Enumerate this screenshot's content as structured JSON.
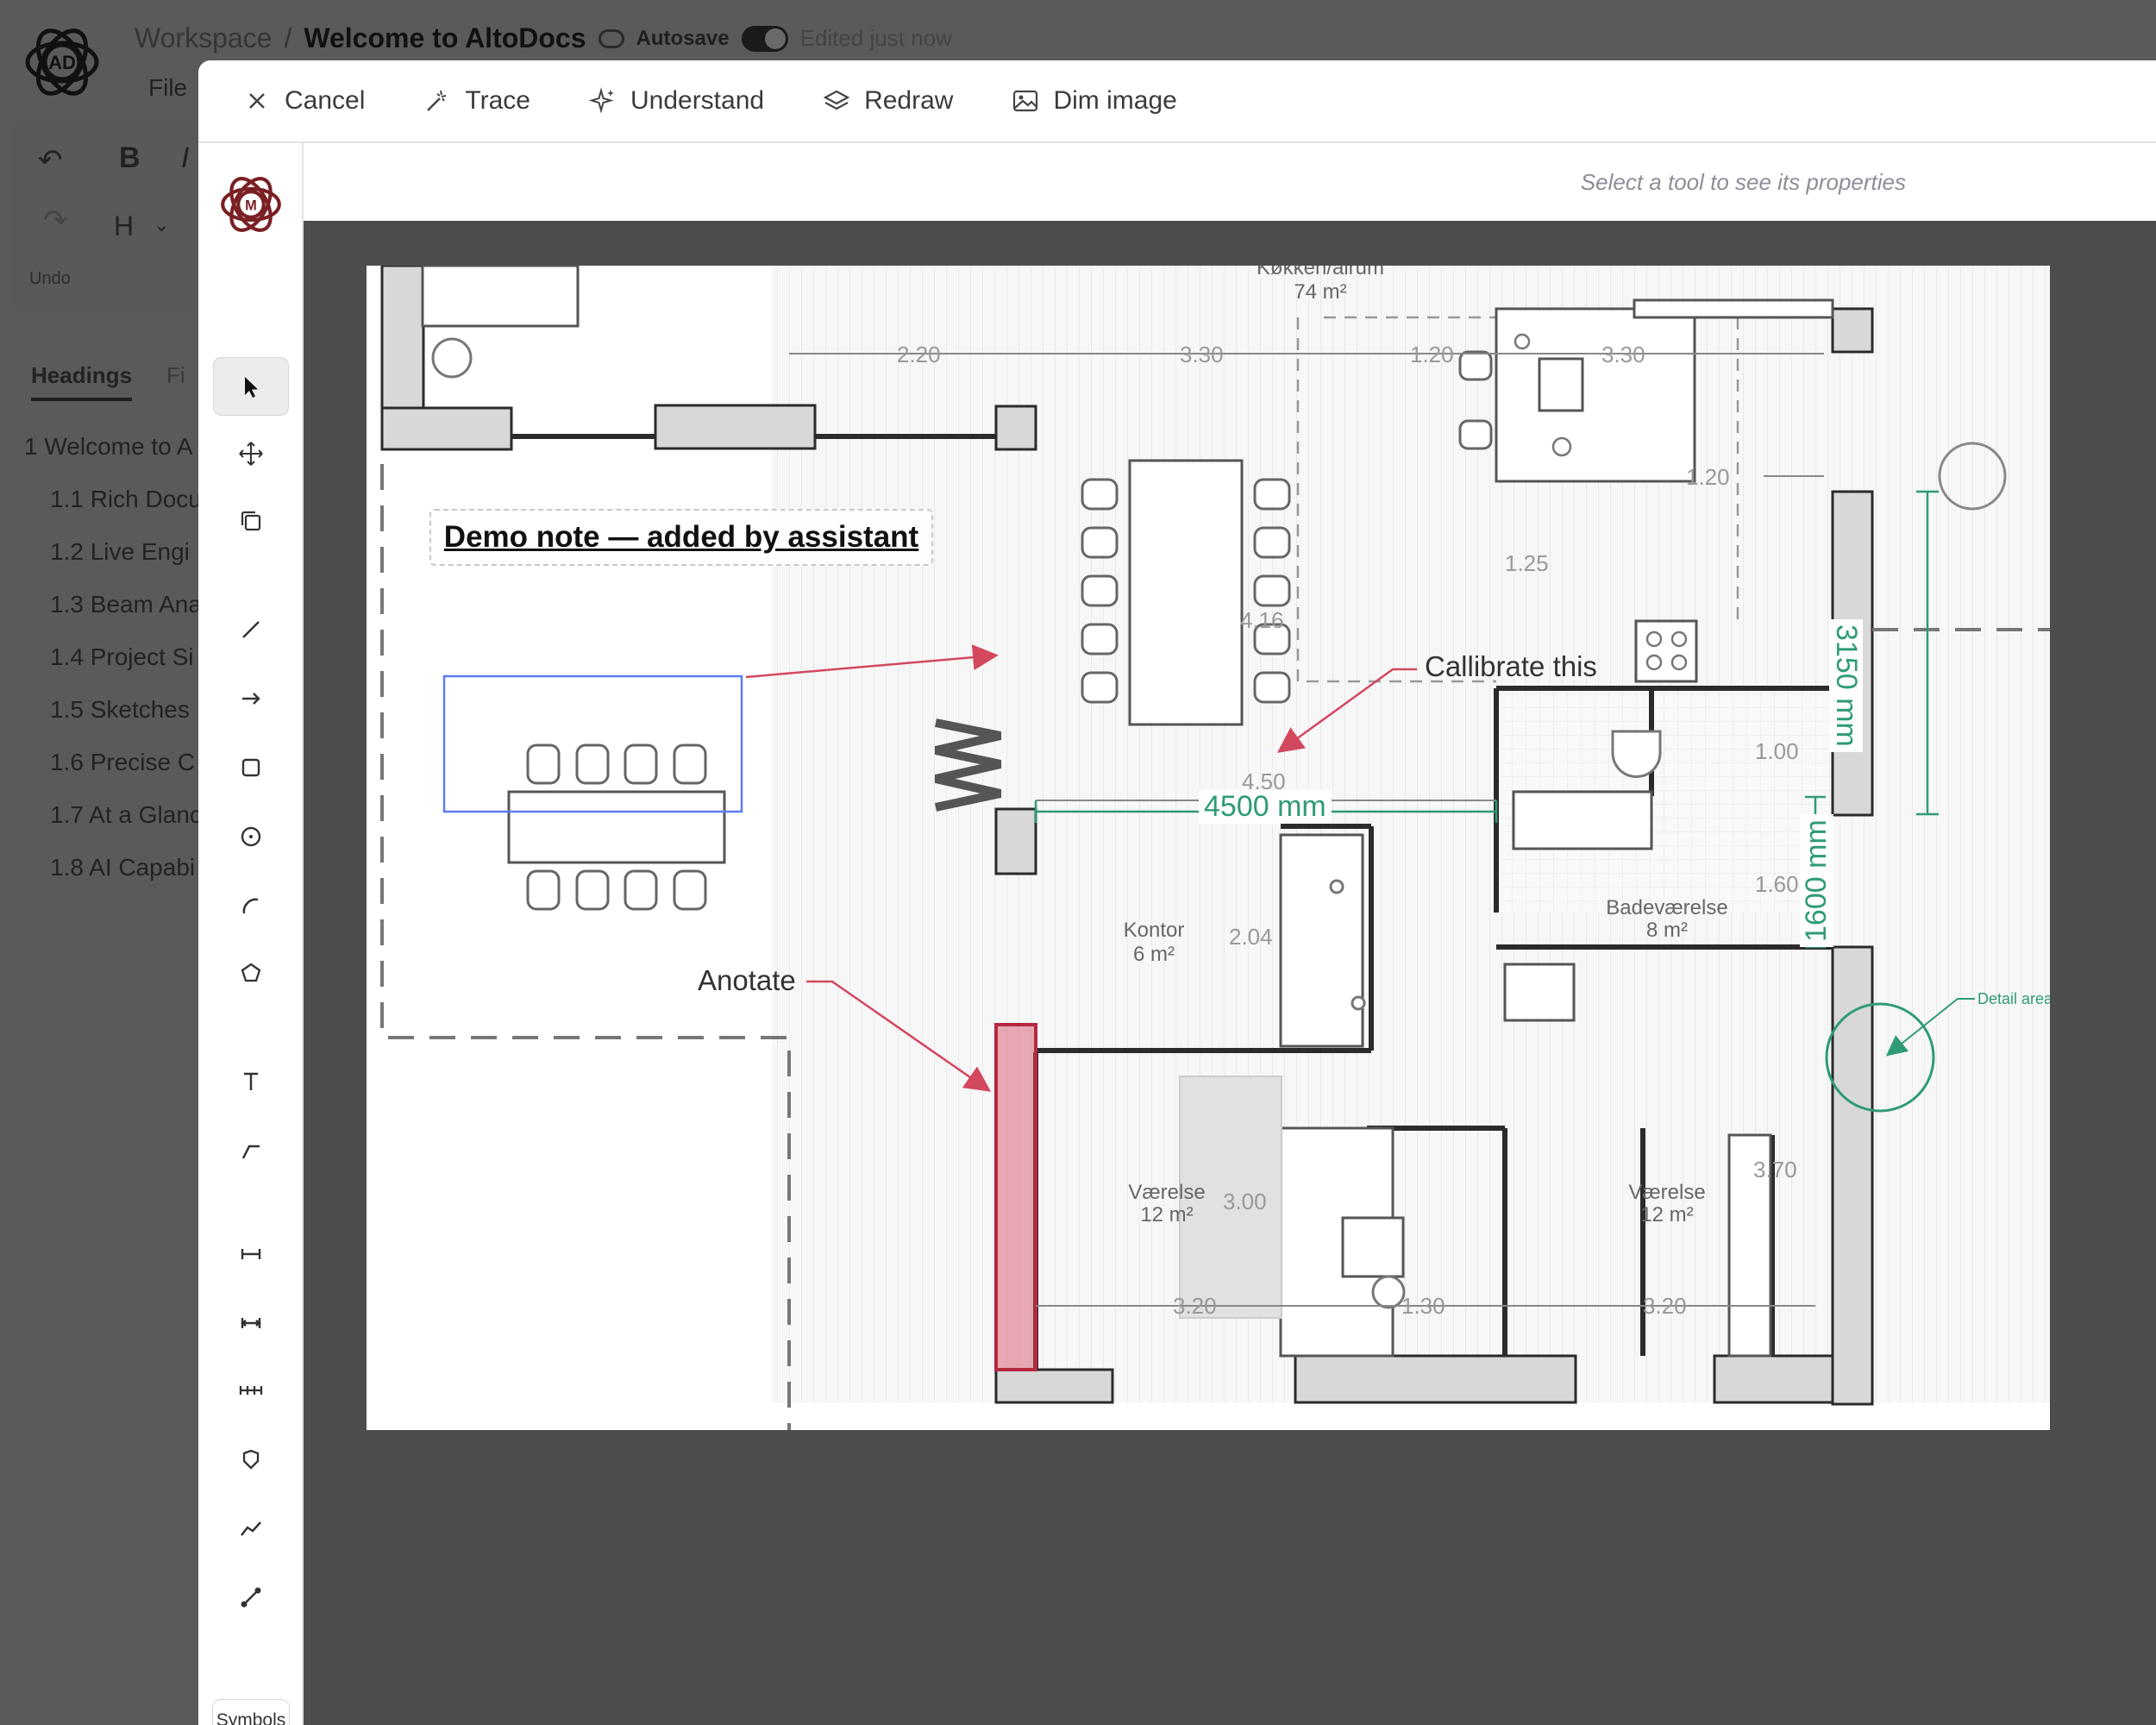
{
  "background_app": {
    "breadcrumb_workspace": "Workspace",
    "breadcrumb_sep": "/",
    "doc_title": "Welcome to AltoDocs",
    "autosave_label": "Autosave",
    "edited_status": "Edited just now",
    "file_menu": "File",
    "toolbar": {
      "bold": "B",
      "italic": "I",
      "heading": "H",
      "undo_label": "Undo"
    },
    "tabs": [
      "Headings",
      "Fi"
    ],
    "outline": [
      {
        "label": "1 Welcome to A",
        "level": 1
      },
      {
        "label": "1.1 Rich Docu",
        "level": 2
      },
      {
        "label": "1.2 Live Engi",
        "level": 2
      },
      {
        "label": "1.3 Beam Ana",
        "level": 2
      },
      {
        "label": "1.4 Project Si",
        "level": 2
      },
      {
        "label": "1.5 Sketches",
        "level": 2
      },
      {
        "label": "1.6 Precise C",
        "level": 2
      },
      {
        "label": "1.7 At a Glanc",
        "level": 2
      },
      {
        "label": "1.8 AI Capabi",
        "level": 2
      }
    ]
  },
  "modal": {
    "topbar": {
      "cancel": "Cancel",
      "trace": "Trace",
      "understand": "Understand",
      "redraw": "Redraw",
      "dim_image": "Dim image"
    },
    "properties_hint": "Select a tool to see its properties",
    "symbols_label": "Symbols",
    "tools": [
      "select",
      "move",
      "copy",
      "line",
      "arrow",
      "rectangle",
      "circle",
      "arc",
      "polygon",
      "text",
      "leader",
      "dimension",
      "aligned-dimension",
      "chain-dimension",
      "area",
      "polyline",
      "calibrate"
    ]
  },
  "plan": {
    "note": "Demo note — added by assistant",
    "annotations": {
      "calibrate": "Callibrate this",
      "annotate": "Anotate",
      "detail_area": "Detail area"
    },
    "dimensions": {
      "d4500": "4500 mm",
      "d3150": "3150 mm",
      "d1600": "1600 mm"
    },
    "room_labels": {
      "kitchen": "Køkken/alrum",
      "kitchen_area": "74 m²",
      "office": "Kontor",
      "office_area": "6 m²",
      "bathroom": "Badeværelse",
      "bathroom_area": "8 m²",
      "room1": "Værelse",
      "room1_area": "12 m²",
      "room2": "Værelse",
      "room2_area": "12 m²"
    },
    "plan_dims": [
      "2.20",
      "3.30",
      "1.20",
      "3.30",
      "1.20",
      "1.25",
      "4.16",
      "4.50",
      "1.00",
      "1.60",
      "2.04",
      "3.00",
      "3.70",
      "3.20",
      "1.30",
      "3.20"
    ],
    "accent_green": "#2f9b74",
    "accent_red": "#d2485f",
    "selection_blue": "#5b7ef5"
  }
}
